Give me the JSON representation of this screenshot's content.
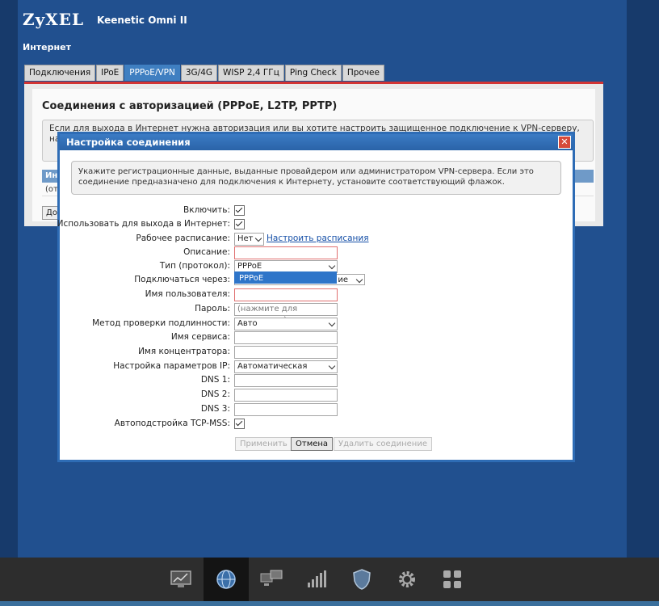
{
  "header": {
    "logo": "ZyXEL",
    "model": "Keenetic Omni II",
    "section": "Интернет"
  },
  "tabs": [
    {
      "label": "Подключения"
    },
    {
      "label": "IPoE"
    },
    {
      "label": "PPPoE/VPN",
      "active": true
    },
    {
      "label": "3G/4G"
    },
    {
      "label": "WISP 2,4 ГГц"
    },
    {
      "label": "Ping Check"
    },
    {
      "label": "Прочее"
    }
  ],
  "panel": {
    "title": "Соединения с авторизацией (PPPoE, L2TP, PPTP)",
    "info": "Если для выхода в Интернет нужна авторизация или вы хотите настроить защищенное подключение к VPN-серверу, например для удаленного дост… спис…",
    "table_head": "Инте",
    "table_row": "(отсу",
    "add_button": "Доба"
  },
  "dialog": {
    "title": "Настройка соединения",
    "close_glyph": "✕",
    "info": "Укажите регистрационные данные, выданные провайдером или администратором VPN-сервера. Если это соединение предназначено для подключения к Интернету, установите соответствующий флажок.",
    "fields": {
      "enable": {
        "label": "Включить:",
        "checked": true
      },
      "use_internet": {
        "label": "Использовать для выхода в Интернет:",
        "checked": true
      },
      "schedule": {
        "label": "Рабочее расписание:",
        "value": "Нет",
        "link": "Настроить расписания"
      },
      "description": {
        "label": "Описание:",
        "value": ""
      },
      "protocol": {
        "label": "Тип (протокол):",
        "value": "PPPoE",
        "dropdown_open": true,
        "options": [
          "PPPoE"
        ]
      },
      "connect_via": {
        "label": "Подключаться через:",
        "value_suffix": "ие"
      },
      "username": {
        "label": "Имя пользователя:",
        "value": ""
      },
      "password": {
        "label": "Пароль:",
        "placeholder": "(нажмите для изменения)"
      },
      "auth_method": {
        "label": "Метод проверки подлинности:",
        "value": "Авто"
      },
      "service_name": {
        "label": "Имя сервиса:",
        "value": ""
      },
      "concentrator": {
        "label": "Имя концентратора:",
        "value": ""
      },
      "ip_settings": {
        "label": "Настройка параметров IP:",
        "value": "Автоматическая"
      },
      "dns1": {
        "label": "DNS 1:",
        "value": ""
      },
      "dns2": {
        "label": "DNS 2:",
        "value": ""
      },
      "dns3": {
        "label": "DNS 3:",
        "value": ""
      },
      "tcp_mss": {
        "label": "Автоподстройка TCP-MSS:",
        "checked": true
      }
    },
    "buttons": {
      "apply": "Применить",
      "cancel": "Отмена",
      "delete": "Удалить соединение"
    }
  },
  "taskbar": [
    {
      "icon": "monitor-chart-icon"
    },
    {
      "icon": "globe-icon",
      "active": true
    },
    {
      "icon": "network-computers-icon"
    },
    {
      "icon": "wifi-signal-icon"
    },
    {
      "icon": "shield-icon"
    },
    {
      "icon": "gear-icon"
    },
    {
      "icon": "apps-grid-icon"
    }
  ],
  "colors": {
    "page_bg": "#1f4d8a",
    "tab_active": "#3f7fc1",
    "tab_underline": "#d23434",
    "dialog_border": "#2e6cb5",
    "dropdown_highlight": "#2e75c9",
    "taskbar": "#2d2d2d"
  }
}
